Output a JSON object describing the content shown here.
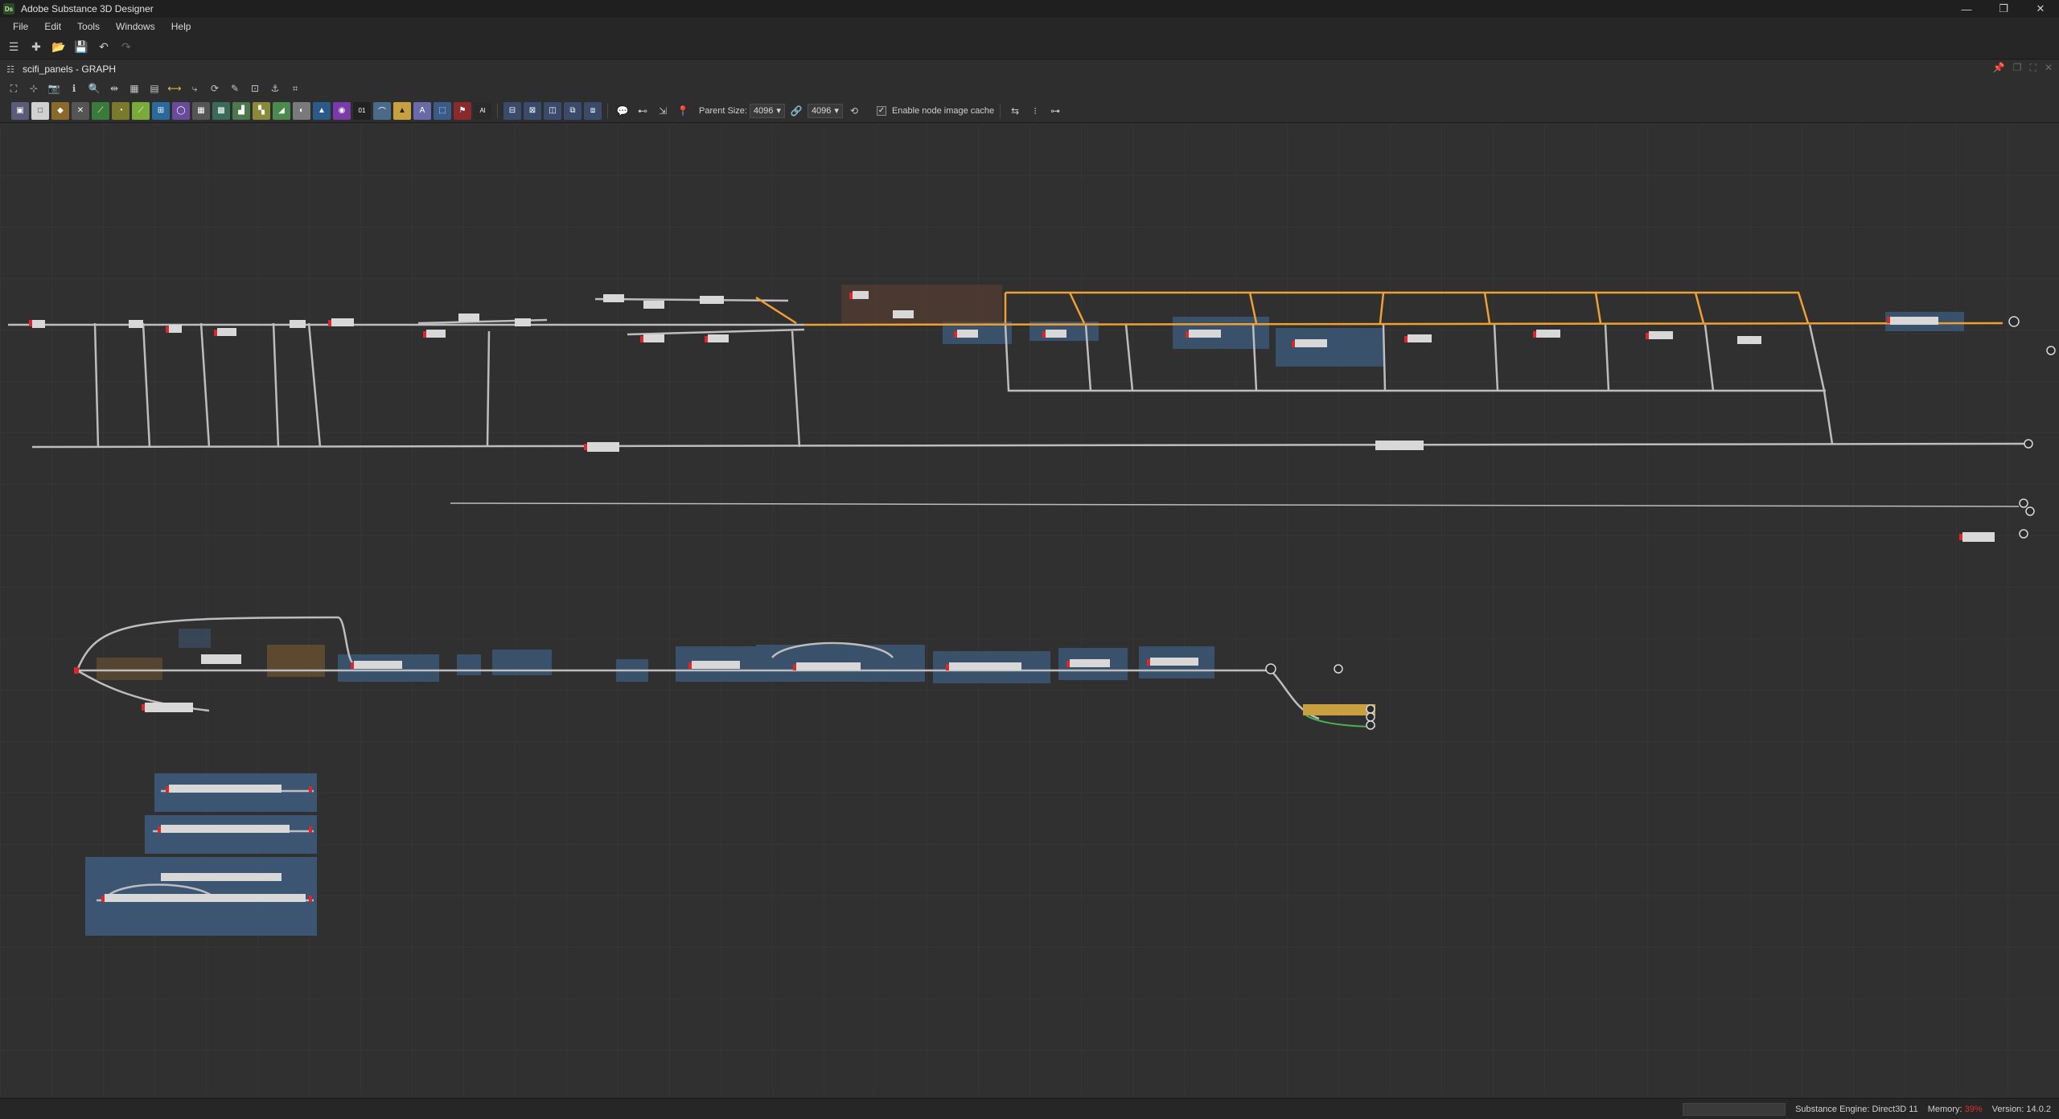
{
  "app": {
    "title": "Adobe Substance 3D Designer",
    "logo": "Ds",
    "window_controls": [
      "—",
      "❐",
      "✕"
    ]
  },
  "menu": [
    "File",
    "Edit",
    "Tools",
    "Windows",
    "Help"
  ],
  "graph": {
    "title": "scifi_panels - GRAPH"
  },
  "graph_toolbar": {
    "parent_size_label": "Parent Size:",
    "parent_size_value": "4096",
    "output_size_value": "4096",
    "cache_label": "Enable node image cache",
    "cache_checked": "✓"
  },
  "status": {
    "engine": "Substance Engine: Direct3D 11",
    "memory_label": "Memory:",
    "memory_value": "39%",
    "version": "Version: 14.0.2"
  },
  "colors": {
    "canvas": "#303030",
    "frame_blue": "#3d5a7a",
    "frame_orange": "#5a4030",
    "link_default": "#bdbdbd",
    "link_active": "#f0a030",
    "link_green": "#4caf50",
    "node_port": "#d8282a"
  }
}
